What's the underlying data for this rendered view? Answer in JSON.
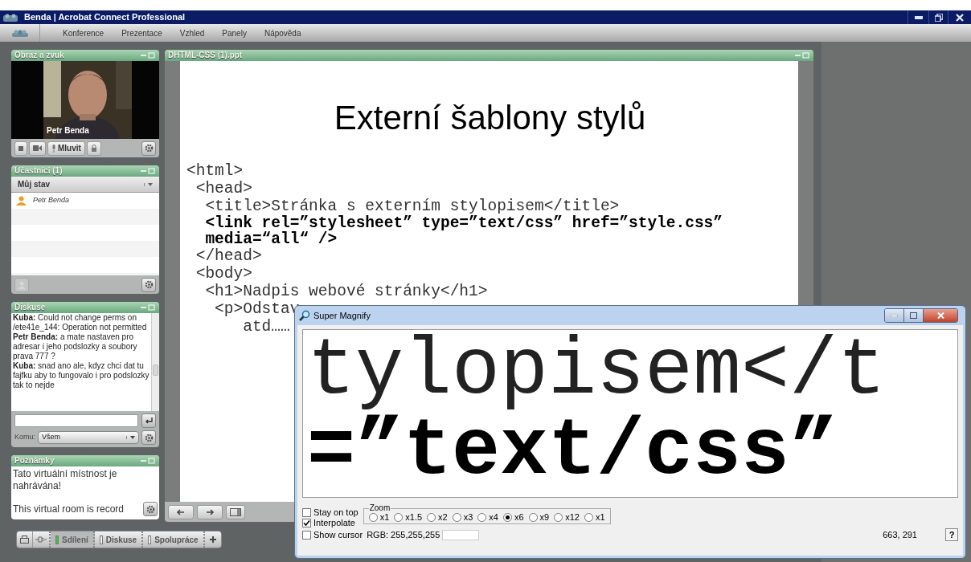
{
  "window": {
    "title": "Benda | Acrobat Connect Professional"
  },
  "menu": [
    "Konference",
    "Prezentace",
    "Vzhled",
    "Panely",
    "Nápověda"
  ],
  "video_pod": {
    "title": "Obraz a zvuk",
    "person": "Petr Benda",
    "talk_button": "Mluvit"
  },
  "attendees_pod": {
    "title": "Účastníci (1)",
    "status_label": "Můj stav",
    "people": [
      {
        "name": "Petr Benda"
      }
    ]
  },
  "chat_pod": {
    "title": "Diskuse",
    "messages": [
      {
        "text": "**Kuba:** Could not change perms on /ete41e_144: Operation not permitted"
      },
      {
        "text": "**Petr Benda:** a mate nastaven pro adresar i jeho podslozky a  soubory prava 777 ?"
      },
      {
        "text": "**Kuba:** snad ano ale, kdyz chci dat tu fajfku aby to fungovalo i pro podslozky tak to nejde"
      }
    ],
    "to_label": "Komu:",
    "to_value": "Všem"
  },
  "notes_pod": {
    "title": "Poznámky",
    "paragraphs": [
      "Tato virtuální místnost je nahrávána!",
      "This virtual room is record"
    ]
  },
  "share_pod": {
    "title": "DHTML-CSS (1).ppt",
    "slide_title": "Externí šablony stylů",
    "code_lines": [
      {
        "text": "<html>",
        "bold": false
      },
      {
        "text": " <head>",
        "bold": false
      },
      {
        "text": "  <title>Stránka s externím stylopisem</title>",
        "bold": false
      },
      {
        "text": "  <link rel=”stylesheet” type=”text/css” href=”style.css”",
        "bold": true
      },
      {
        "text": "  media=“all“ />",
        "bold": true
      },
      {
        "text": " </head>",
        "bold": false
      },
      {
        "text": " <body>",
        "bold": false
      },
      {
        "text": "  <h1>Nadpis webové stránky</h1>",
        "bold": false
      },
      {
        "text": "   <p>Odstav",
        "bold": false
      },
      {
        "text": "      atd……",
        "bold": false
      }
    ]
  },
  "layout_tabs": [
    {
      "label": "Sdílení",
      "selected": true
    },
    {
      "label": "Diskuse",
      "selected": false
    },
    {
      "label": "Spolupráce",
      "selected": false
    }
  ],
  "magnifier": {
    "title": "Super Magnify",
    "magnified_lines": [
      {
        "text": "tylopisem</t",
        "bold": false
      },
      {
        "text": "=”text/css”",
        "bold": true
      }
    ],
    "options": [
      {
        "label": "Stay on top",
        "checked": false
      },
      {
        "label": "Interpolate",
        "checked": true
      },
      {
        "label": "Show cursor",
        "checked": false
      }
    ],
    "zoom_label": "Zoom",
    "zoom_levels": [
      {
        "label": "x1",
        "selected": false
      },
      {
        "label": "x1.5",
        "selected": false
      },
      {
        "label": "x2",
        "selected": false
      },
      {
        "label": "x3",
        "selected": false
      },
      {
        "label": "x4",
        "selected": false
      },
      {
        "label": "x6",
        "selected": true
      },
      {
        "label": "x9",
        "selected": false
      },
      {
        "label": "x12",
        "selected": false
      },
      {
        "label": "x1",
        "selected": false
      }
    ],
    "rgb": "RGB: 255,255,255",
    "color": "#ffffff",
    "coords": "663, 291",
    "help": "?"
  }
}
